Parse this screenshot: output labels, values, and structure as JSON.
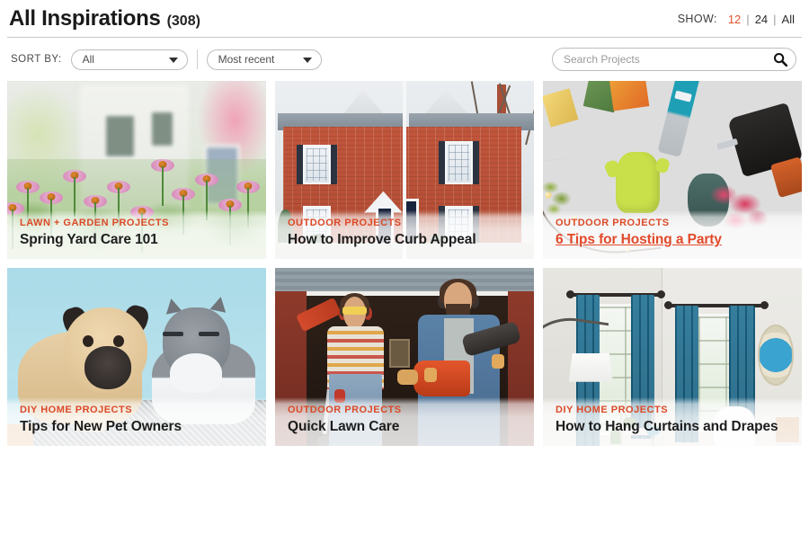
{
  "header": {
    "title": "All Inspirations",
    "count": "(308)",
    "show_label": "SHOW:",
    "show_options": [
      {
        "label": "12",
        "active": true
      },
      {
        "label": "24",
        "active": false
      },
      {
        "label": "All",
        "active": false
      }
    ],
    "separator": "|"
  },
  "toolbar": {
    "sort_label": "SORT BY:",
    "category_select": {
      "value": "All",
      "options": [
        "All"
      ]
    },
    "order_select": {
      "value": "Most recent",
      "options": [
        "Most recent"
      ]
    },
    "search": {
      "value": "",
      "placeholder": "Search Projects",
      "icon": "search-icon"
    }
  },
  "cards": [
    {
      "category": "LAWN + GARDEN PROJECTS",
      "title": "Spring Yard Care 101",
      "image_alt": "purple coneflowers blooming in front of a blurred white house",
      "hovered": false
    },
    {
      "category": "OUTDOOR PROJECTS",
      "title": "How to Improve Curb Appeal",
      "image_alt": "before and after split view of a red brick colonial house",
      "hovered": false
    },
    {
      "category": "OUTDOOR PROJECTS",
      "title": "6 Tips for Hosting a Party",
      "image_alt": "overhead flat lay of garden gloves, drill, string lights and flowers on stone patio",
      "hovered": true
    },
    {
      "category": "DIY HOME PROJECTS",
      "title": "Tips for New Pet Owners",
      "image_alt": "pug dog and gray and white cat resting on a bed against light blue background",
      "hovered": false
    },
    {
      "category": "OUTDOOR PROJECTS",
      "title": "Quick Lawn Care",
      "image_alt": "woman and man holding a string trimmer and leaf blower in a garage doorway",
      "hovered": false
    },
    {
      "category": "DIY HOME PROJECTS",
      "title": "How to Hang Curtains and Drapes",
      "image_alt": "living room corner with teal blue curtains on two windows and a round mirror",
      "hovered": false
    }
  ],
  "colors": {
    "accent": "#dc4a28",
    "hover_link": "#e2492a",
    "title_text": "#1d1d1d",
    "rule": "#c9c9c9",
    "border": "#bdbdbd"
  }
}
